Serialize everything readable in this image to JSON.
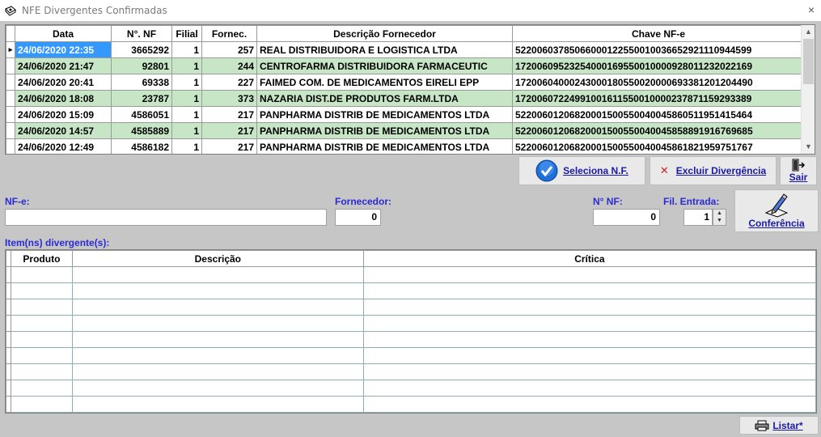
{
  "window": {
    "title": "NFE Divergentes Confirmadas",
    "close_glyph": "×"
  },
  "top_grid": {
    "headers": [
      "Data",
      "N°. NF",
      "Filial",
      "Fornec.",
      "Descrição Fornecedor",
      "Chave NF-e"
    ],
    "rows": [
      {
        "data": "24/06/2020 22:35",
        "nf": "3665292",
        "filial": "1",
        "fornec": "257",
        "descricao": "REAL DISTRIBUIDORA E LOGISTICA LTDA",
        "chave": "52200603785066000122550010036652921110944599"
      },
      {
        "data": "24/06/2020 21:47",
        "nf": "92801",
        "filial": "1",
        "fornec": "244",
        "descricao": "CENTROFARMA DISTRIBUIDORA FARMACEUTIC",
        "chave": "17200609523254000169550010000928011232022169"
      },
      {
        "data": "24/06/2020 20:41",
        "nf": "69338",
        "filial": "1",
        "fornec": "227",
        "descricao": "FAIMED COM. DE MEDICAMENTOS EIRELI EPP",
        "chave": "17200604000243000180550020000693381201204490"
      },
      {
        "data": "24/06/2020 18:08",
        "nf": "23787",
        "filial": "1",
        "fornec": "373",
        "descricao": "NAZARIA DIST.DE PRODUTOS FARM.LTDA",
        "chave": "17200607224991001611550010000237871159293389"
      },
      {
        "data": "24/06/2020 15:09",
        "nf": "4586051",
        "filial": "1",
        "fornec": "217",
        "descricao": "PANPHARMA DISTRIB DE MEDICAMENTOS LTDA",
        "chave": "52200601206820001500550040045860511951415464"
      },
      {
        "data": "24/06/2020 14:57",
        "nf": "4585889",
        "filial": "1",
        "fornec": "217",
        "descricao": "PANPHARMA DISTRIB DE MEDICAMENTOS LTDA",
        "chave": "52200601206820001500550040045858891916769685"
      },
      {
        "data": "24/06/2020 12:49",
        "nf": "4586182",
        "filial": "1",
        "fornec": "217",
        "descricao": "PANPHARMA DISTRIB DE MEDICAMENTOS LTDA",
        "chave": "52200601206820001500550040045861821959751767"
      }
    ]
  },
  "buttons": {
    "seleciona": "Seleciona N.F.",
    "excluir": "Excluir Divergência",
    "sair": "Sair",
    "conferencia": "Conferência",
    "listar": "Listar*"
  },
  "form": {
    "nfe_label": "NF-e:",
    "nfe_value": "",
    "fornecedor_label": "Fornecedor:",
    "fornecedor_value": "0",
    "nnf_label": "N° NF:",
    "nnf_value": "0",
    "filial_label": "Fil. Entrada:",
    "filial_value": "1"
  },
  "bottom_grid": {
    "title": "Item(ns) divergente(s):",
    "headers": [
      "Produto",
      "Descrição",
      "Crítica"
    ],
    "empty_rows": 9
  },
  "colors": {
    "selection": "#3399ff",
    "alt_row": "#c6e6c6",
    "label_blue": "#2b2bd6",
    "button_text": "#1a1aa6"
  }
}
